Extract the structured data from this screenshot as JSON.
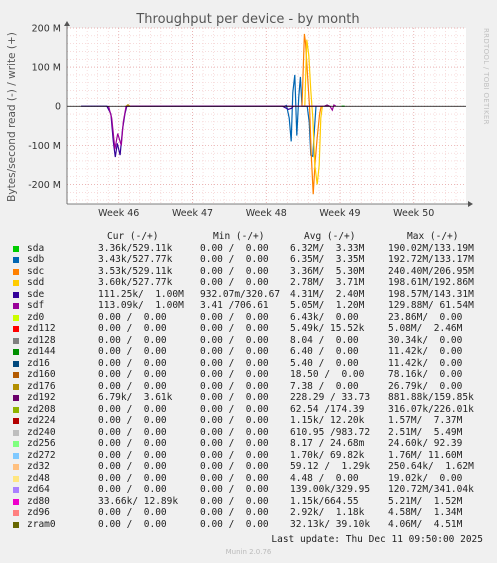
{
  "chart_data": {
    "type": "line",
    "title": "Throughput per device - by month",
    "ylabel": "Bytes/second read (-) / write (+)",
    "side_label": "RRDTOOL / TOBI OETIKER",
    "ylim": [
      -250000000,
      200000000
    ],
    "y_ticks": [
      {
        "value": 200000000,
        "label": "200 M"
      },
      {
        "value": 100000000,
        "label": "100 M"
      },
      {
        "value": 0,
        "label": "0"
      },
      {
        "value": -100000000,
        "label": "-100 M"
      },
      {
        "value": -200000000,
        "label": "-200 M"
      }
    ],
    "x_ticks": [
      {
        "label": "Week 46",
        "pos": 0.1297
      },
      {
        "label": "Week 47",
        "pos": 0.3146
      },
      {
        "label": "Week 48",
        "pos": 0.4994
      },
      {
        "label": "Week 49",
        "pos": 0.6842
      },
      {
        "label": "Week 50",
        "pos": 0.869
      }
    ],
    "series": [
      {
        "name": "sda",
        "color": "#00cc00",
        "points": [
          [
            0.688,
            0
          ],
          [
            0.696,
            0
          ]
        ]
      },
      {
        "name": "sdb",
        "color": "#0066b3",
        "points": [
          [
            0.545,
            0
          ],
          [
            0.55,
            2000000
          ],
          [
            0.557,
            -30000000
          ],
          [
            0.562,
            -90000000
          ],
          [
            0.566,
            35000000
          ],
          [
            0.571,
            80000000
          ],
          [
            0.576,
            -75000000
          ],
          [
            0.581,
            25000000
          ],
          [
            0.585,
            75000000
          ],
          [
            0.589,
            0
          ],
          [
            0.593,
            0
          ],
          [
            0.602,
            0
          ],
          [
            0.607,
            -40000000
          ],
          [
            0.611,
            -125000000
          ],
          [
            0.616,
            -128000000
          ],
          [
            0.62,
            -60000000
          ],
          [
            0.624,
            0
          ]
        ]
      },
      {
        "name": "sdc",
        "color": "#ff8000",
        "points": [
          [
            0.589,
            0
          ],
          [
            0.595,
            185000000
          ],
          [
            0.598,
            160000000
          ],
          [
            0.604,
            60000000
          ],
          [
            0.608,
            -5000000
          ],
          [
            0.612,
            -120000000
          ],
          [
            0.617,
            -225000000
          ],
          [
            0.622,
            -140000000
          ],
          [
            0.627,
            -80000000
          ],
          [
            0.633,
            -20000000
          ],
          [
            0.637,
            0
          ]
        ]
      },
      {
        "name": "sdd",
        "color": "#ffcc00",
        "points": [
          [
            0.596,
            0
          ],
          [
            0.601,
            170000000
          ],
          [
            0.606,
            130000000
          ],
          [
            0.611,
            40000000
          ],
          [
            0.616,
            -30000000
          ],
          [
            0.621,
            -150000000
          ],
          [
            0.627,
            -200000000
          ],
          [
            0.632,
            -150000000
          ],
          [
            0.636,
            -30000000
          ],
          [
            0.64,
            0
          ]
        ]
      },
      {
        "name": "sde",
        "color": "#330099",
        "points": [
          [
            0.035,
            0
          ],
          [
            0.1,
            0
          ],
          [
            0.11,
            -20000000
          ],
          [
            0.116,
            -90000000
          ],
          [
            0.121,
            -130000000
          ],
          [
            0.126,
            -95000000
          ],
          [
            0.133,
            -125000000
          ],
          [
            0.139,
            -60000000
          ],
          [
            0.145,
            -20000000
          ],
          [
            0.15,
            0
          ],
          [
            0.54,
            0
          ],
          [
            0.555,
            -8000000
          ],
          [
            0.563,
            -5000000
          ],
          [
            0.567,
            0
          ]
        ]
      },
      {
        "name": "sdf",
        "color": "#990099",
        "points": [
          [
            0.104,
            0
          ],
          [
            0.112,
            -30000000
          ],
          [
            0.12,
            -110000000
          ],
          [
            0.127,
            -70000000
          ],
          [
            0.136,
            -100000000
          ],
          [
            0.141,
            -40000000
          ],
          [
            0.148,
            0
          ],
          [
            0.659,
            0
          ],
          [
            0.665,
            -10000000
          ],
          [
            0.669,
            3000000
          ],
          [
            0.674,
            0
          ]
        ]
      },
      {
        "name": "zd0",
        "color": "#ccff00",
        "points": []
      },
      {
        "name": "zd112",
        "color": "#ff0000",
        "points": []
      },
      {
        "name": "zd128",
        "color": "#808080",
        "points": []
      },
      {
        "name": "zd144",
        "color": "#008f00",
        "points": []
      },
      {
        "name": "zd16",
        "color": "#00487d",
        "points": []
      },
      {
        "name": "zd160",
        "color": "#b35a00",
        "points": []
      },
      {
        "name": "zd176",
        "color": "#b38f00",
        "points": [
          [
            0.148,
            0
          ],
          [
            0.153,
            4000000
          ],
          [
            0.158,
            0
          ]
        ]
      },
      {
        "name": "zd192",
        "color": "#6b006b",
        "points": [
          [
            0.645,
            0
          ],
          [
            0.652,
            3000000
          ],
          [
            0.658,
            0
          ]
        ]
      },
      {
        "name": "zd208",
        "color": "#8fb300",
        "points": []
      },
      {
        "name": "zd224",
        "color": "#b30000",
        "points": []
      },
      {
        "name": "zd240",
        "color": "#bebebe",
        "points": []
      },
      {
        "name": "zd256",
        "color": "#80ff80",
        "points": []
      },
      {
        "name": "zd272",
        "color": "#80c9ff",
        "points": []
      },
      {
        "name": "zd32",
        "color": "#ffc080",
        "points": []
      },
      {
        "name": "zd48",
        "color": "#ffe680",
        "points": []
      },
      {
        "name": "zd64",
        "color": "#aa80ff",
        "points": []
      },
      {
        "name": "zd80",
        "color": "#ee00cc",
        "points": []
      },
      {
        "name": "zd96",
        "color": "#ff8080",
        "points": []
      },
      {
        "name": "zram0",
        "color": "#666600",
        "points": []
      }
    ]
  },
  "legend": {
    "headers": {
      "cur": "Cur (-/+)",
      "min": "Min (-/+)",
      "avg": "Avg (-/+)",
      "max": "Max (-/+)"
    },
    "rows": [
      {
        "name": "sda",
        "color": "#00cc00",
        "cur": "3.36k/529.11k",
        "min": "0.00 /  0.00",
        "avg": "6.32M/  3.33M",
        "max": "190.02M/133.19M"
      },
      {
        "name": "sdb",
        "color": "#0066b3",
        "cur": "3.43k/527.77k",
        "min": "0.00 /  0.00",
        "avg": "6.35M/  3.35M",
        "max": "192.72M/133.17M"
      },
      {
        "name": "sdc",
        "color": "#ff8000",
        "cur": "3.53k/529.11k",
        "min": "0.00 /  0.00",
        "avg": "3.36M/  5.30M",
        "max": "240.40M/206.95M"
      },
      {
        "name": "sdd",
        "color": "#ffcc00",
        "cur": "3.60k/527.77k",
        "min": "0.00 /  0.00",
        "avg": "2.78M/  3.71M",
        "max": "198.61M/192.86M"
      },
      {
        "name": "sde",
        "color": "#330099",
        "cur": "111.25k/  1.00M",
        "min": "932.07m/320.67",
        "avg": "4.31M/  2.40M",
        "max": "198.57M/143.31M"
      },
      {
        "name": "sdf",
        "color": "#990099",
        "cur": "113.09k/  1.00M",
        "min": "3.41 /706.61",
        "avg": "5.05M/  1.20M",
        "max": "129.88M/ 61.54M"
      },
      {
        "name": "zd0",
        "color": "#ccff00",
        "cur": "0.00 /  0.00",
        "min": "0.00 /  0.00",
        "avg": "6.43k/  0.00",
        "max": "23.86M/  0.00"
      },
      {
        "name": "zd112",
        "color": "#ff0000",
        "cur": "0.00 /  0.00",
        "min": "0.00 /  0.00",
        "avg": "5.49k/ 15.52k",
        "max": "5.08M/  2.46M"
      },
      {
        "name": "zd128",
        "color": "#808080",
        "cur": "0.00 /  0.00",
        "min": "0.00 /  0.00",
        "avg": "8.04 /  0.00",
        "max": "30.34k/  0.00"
      },
      {
        "name": "zd144",
        "color": "#008f00",
        "cur": "0.00 /  0.00",
        "min": "0.00 /  0.00",
        "avg": "6.40 /  0.00",
        "max": "11.42k/  0.00"
      },
      {
        "name": "zd16",
        "color": "#00487d",
        "cur": "0.00 /  0.00",
        "min": "0.00 /  0.00",
        "avg": "5.40 /  0.00",
        "max": "11.42k/  0.00"
      },
      {
        "name": "zd160",
        "color": "#b35a00",
        "cur": "0.00 /  0.00",
        "min": "0.00 /  0.00",
        "avg": "18.50 /  0.00",
        "max": "78.16k/  0.00"
      },
      {
        "name": "zd176",
        "color": "#b38f00",
        "cur": "0.00 /  0.00",
        "min": "0.00 /  0.00",
        "avg": "7.38 /  0.00",
        "max": "26.79k/  0.00"
      },
      {
        "name": "zd192",
        "color": "#6b006b",
        "cur": "6.79k/  3.61k",
        "min": "0.00 /  0.00",
        "avg": "228.29 / 33.73",
        "max": "881.88k/159.85k"
      },
      {
        "name": "zd208",
        "color": "#8fb300",
        "cur": "0.00 /  0.00",
        "min": "0.00 /  0.00",
        "avg": "62.54 /174.39",
        "max": "316.07k/226.01k"
      },
      {
        "name": "zd224",
        "color": "#b30000",
        "cur": "0.00 /  0.00",
        "min": "0.00 /  0.00",
        "avg": "1.15k/ 12.20k",
        "max": "1.57M/  7.37M"
      },
      {
        "name": "zd240",
        "color": "#bebebe",
        "cur": "0.00 /  0.00",
        "min": "0.00 /  0.00",
        "avg": "610.95 /983.72",
        "max": "2.51M/  5.49M"
      },
      {
        "name": "zd256",
        "color": "#80ff80",
        "cur": "0.00 /  0.00",
        "min": "0.00 /  0.00",
        "avg": "8.17 / 24.68m",
        "max": "24.60k/ 92.39"
      },
      {
        "name": "zd272",
        "color": "#80c9ff",
        "cur": "0.00 /  0.00",
        "min": "0.00 /  0.00",
        "avg": "1.70k/ 69.82k",
        "max": "1.76M/ 11.60M"
      },
      {
        "name": "zd32",
        "color": "#ffc080",
        "cur": "0.00 /  0.00",
        "min": "0.00 /  0.00",
        "avg": "59.12 /  1.29k",
        "max": "250.64k/  1.62M"
      },
      {
        "name": "zd48",
        "color": "#ffe680",
        "cur": "0.00 /  0.00",
        "min": "0.00 /  0.00",
        "avg": "4.48 /  0.00",
        "max": "19.02k/  0.00"
      },
      {
        "name": "zd64",
        "color": "#aa80ff",
        "cur": "0.00 /  0.00",
        "min": "0.00 /  0.00",
        "avg": "139.00k/329.95",
        "max": "120.72M/341.04k"
      },
      {
        "name": "zd80",
        "color": "#ee00cc",
        "cur": "33.66k/ 12.89k",
        "min": "0.00 /  0.00",
        "avg": "1.15k/664.55",
        "max": "5.21M/  1.52M"
      },
      {
        "name": "zd96",
        "color": "#ff8080",
        "cur": "0.00 /  0.00",
        "min": "0.00 /  0.00",
        "avg": "2.92k/  1.18k",
        "max": "4.58M/  1.34M"
      },
      {
        "name": "zram0",
        "color": "#666600",
        "cur": "0.00 /  0.00",
        "min": "0.00 /  0.00",
        "avg": "32.13k/ 39.10k",
        "max": "4.06M/  4.51M"
      }
    ]
  },
  "footer": {
    "last_update": "Last update: Thu Dec 11 09:50:00 2025",
    "version": "Munin 2.0.76"
  }
}
